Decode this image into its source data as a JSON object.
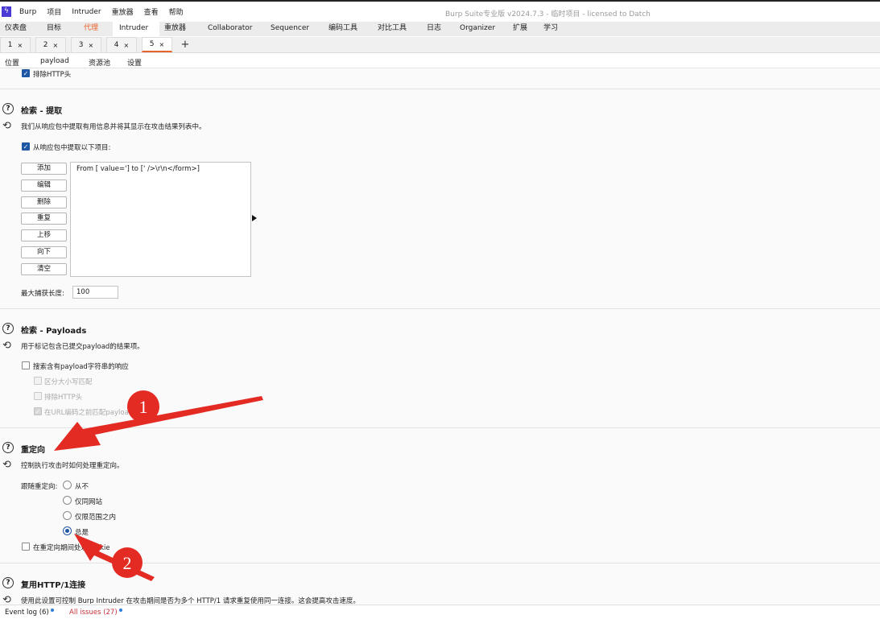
{
  "app": {
    "window_title": "Burp Suite专业版  v2024.7.3 - 临时项目 - licensed to Datch",
    "menu": [
      "Burp",
      "项目",
      "Intruder",
      "重放器",
      "查看",
      "帮助"
    ]
  },
  "tools": [
    "仪表盘",
    "目标",
    "代理",
    "Intruder",
    "重放器",
    "Collaborator",
    "Sequencer",
    "编码工具",
    "对比工具",
    "日志",
    "Organizer",
    "扩展",
    "学习"
  ],
  "intruder_tabs": [
    "1",
    "2",
    "3",
    "4",
    "5"
  ],
  "close_glyph": "×",
  "plus_glyph": "+",
  "subtabs": [
    "位置",
    "payload",
    "资源池",
    "设置"
  ],
  "top_checkbox": {
    "label": "排除HTTP头",
    "checked": true
  },
  "grep_extract": {
    "title": "检索 - 提取",
    "description": "我们从响应包中提取有用信息并将其显示在攻击结果列表中。",
    "extract_checkbox": "从响应包中提取以下项目:",
    "buttons": [
      "添加",
      "编辑",
      "删除",
      "重复",
      "上移",
      "向下",
      "清空"
    ],
    "items": [
      "From [ value='] to [' />\\r\\n</form>]"
    ],
    "max_capture_label": "最大捕获长度:",
    "max_capture_value": "100"
  },
  "grep_payloads": {
    "title": "检索 - Payloads",
    "description": "用于标记包含已提交payload的结果项。",
    "search_checkbox": "搜索含有payload字符串的响应",
    "options": [
      "区分大小写匹配",
      "排除HTTP头",
      "在URL编码之前匹配payloads"
    ]
  },
  "redirections": {
    "title": "重定向",
    "description": "控制执行攻击时如何处理重定向。",
    "follow_label": "跟随重定向:",
    "options": [
      "从不",
      "仅同网站",
      "仅限范围之内",
      "总是"
    ],
    "selected": "总是",
    "cookie_checkbox": "在重定向期间处理cookie"
  },
  "http1_reuse": {
    "title": "复用HTTP/1连接",
    "description": "使用此设置可控制 Burp Intruder 在攻击期间是否为多个 HTTP/1 请求重复使用同一连接。这会提高攻击速度。"
  },
  "status": {
    "event_log": "Event log (6)",
    "all_issues": "All issues (27)"
  },
  "annotations": {
    "marker1": "1",
    "marker2": "2"
  },
  "colors": {
    "accent": "#e8632b",
    "annotation_red": "#e32b24",
    "checkbox_blue": "#1f57a4",
    "logo": "#4b3bd6"
  },
  "icons": {
    "help": "?",
    "reset": "⟲",
    "check": "✓",
    "logo": "ϟ"
  }
}
